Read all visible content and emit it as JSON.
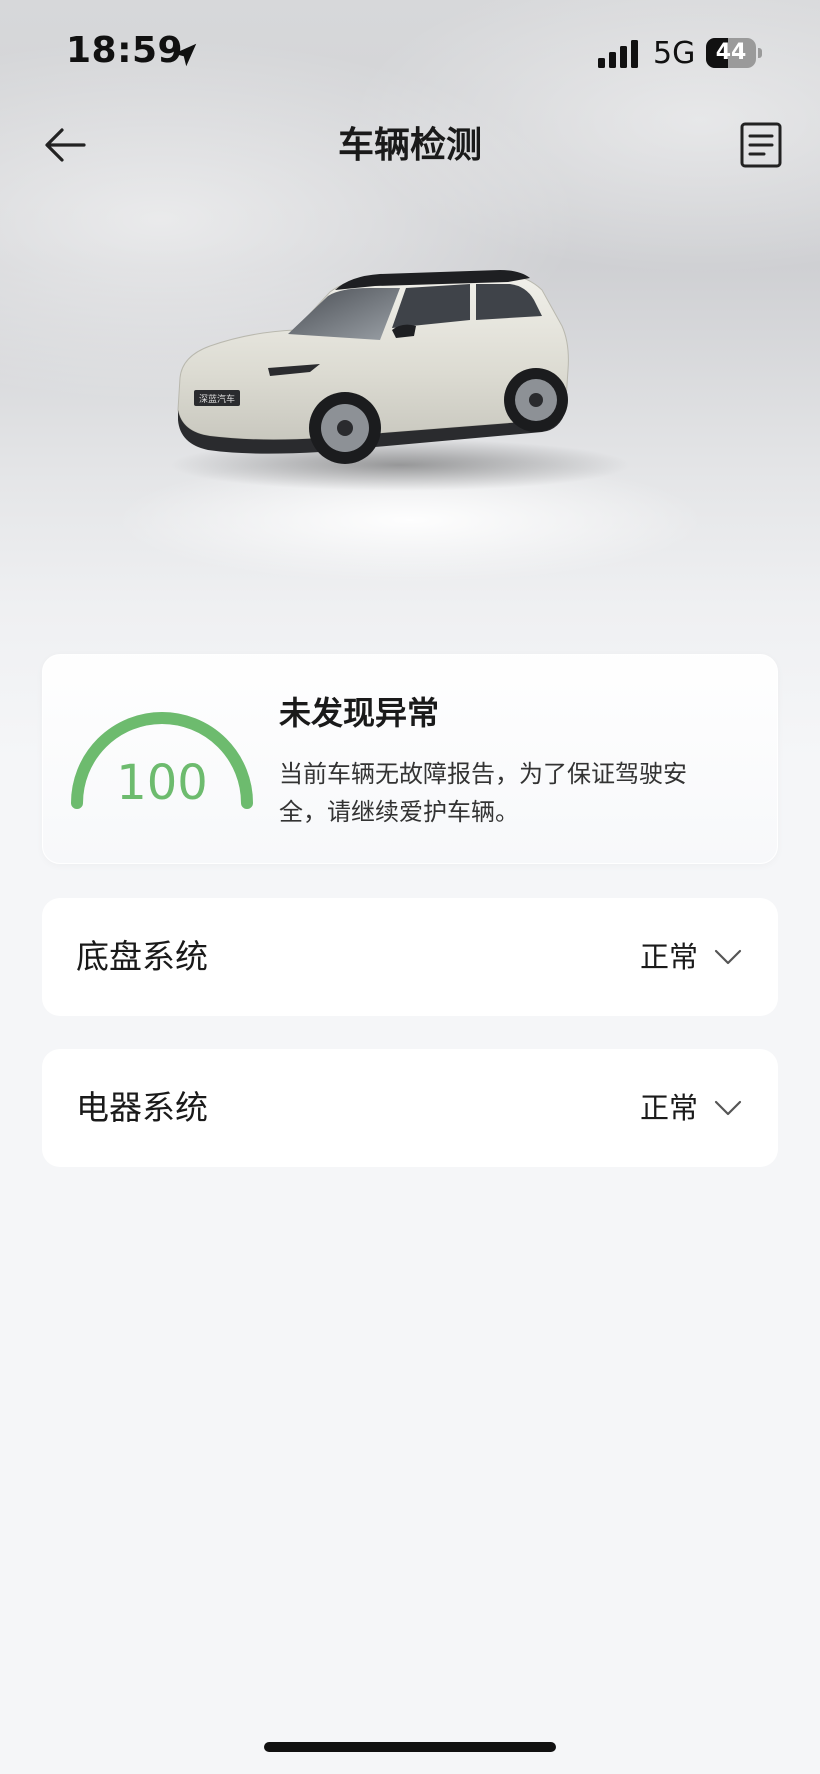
{
  "status_bar": {
    "time": "18:59",
    "network": "5G",
    "battery_level": "44",
    "battery_fraction": 0.44
  },
  "header": {
    "title": "车辆检测",
    "back_icon": "arrow-left-icon",
    "report_icon": "document-icon"
  },
  "vehicle": {
    "plate_text": "深蓝汽车"
  },
  "score_card": {
    "score": "100",
    "score_fraction": 1.0,
    "title": "未发现异常",
    "description": "当前车辆无故障报告，为了保证驾驶安全，请继续爱护车辆。"
  },
  "systems": [
    {
      "name": "底盘系统",
      "status": "正常"
    },
    {
      "name": "电器系统",
      "status": "正常"
    }
  ],
  "colors": {
    "accent_green": "#6dbb6e",
    "background": "#f5f6f8"
  }
}
